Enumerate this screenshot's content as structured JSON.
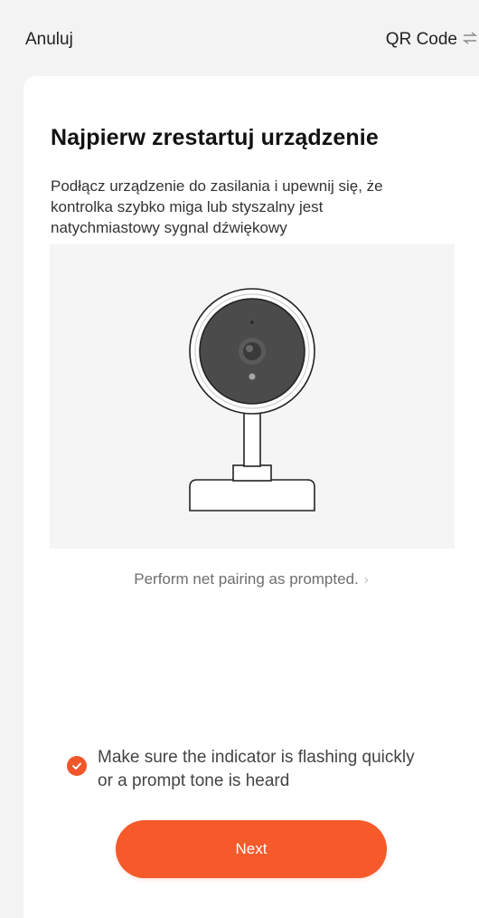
{
  "header": {
    "cancel_label": "Anuluj",
    "qr_label": "QR Code",
    "qr_icon": "swap-arrows-icon"
  },
  "card": {
    "title": "Najpierw zrestartuj urządzenie",
    "description": "Podłącz urządzenie do zasilania i upewnij się, że kontrolka szybko miga lub styszalny jest natychmiastowy sygnal dźwiękowy",
    "illustration": "camera-icon",
    "pairing_link": "Perform net pairing as prompted.",
    "pairing_chevron": "›",
    "confirm_text": "Make sure the indicator is flashing quickly or a prompt tone is heard",
    "confirm_checked": true,
    "next_label": "Next"
  },
  "colors": {
    "accent": "#f65a2b",
    "background": "#f3f3f3",
    "card": "#ffffff",
    "illustration_bg": "#f5f5f5"
  }
}
